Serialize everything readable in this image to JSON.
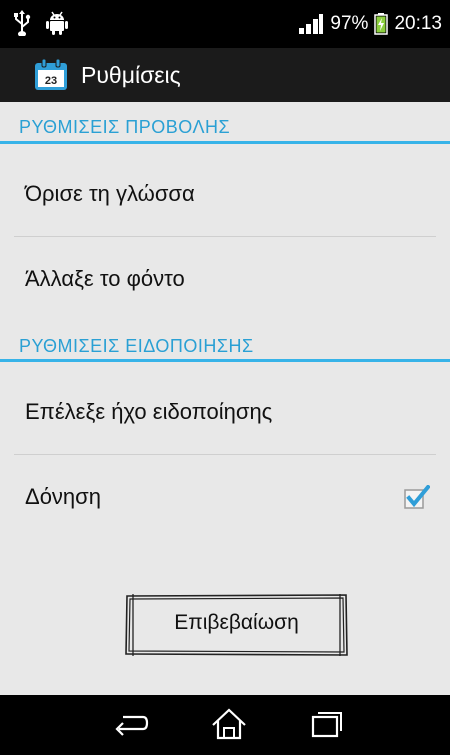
{
  "status_bar": {
    "icons": [
      "usb-icon",
      "android-icon",
      "signal-icon",
      "battery-charging-icon"
    ],
    "battery_percent": "97%",
    "time": "20:13"
  },
  "action_bar": {
    "app_icon": "calendar-icon",
    "app_icon_number": "23",
    "title": "Ρυθμίσεις"
  },
  "sections": [
    {
      "header": "ΡΥΘΜΙΣΕΙΣ ΠΡΟΒΟΛΗΣ",
      "items": [
        {
          "label": "Όρισε τη γλώσσα"
        },
        {
          "label": "Άλλαξε το φόντο"
        }
      ]
    },
    {
      "header": "ΡΥΘΜΙΣΕΙΣ ΕΙΔΟΠΟΙΗΣΗΣ",
      "items": [
        {
          "label": "Επέλεξε ήχο ειδοποίησης"
        },
        {
          "label": "Δόνηση",
          "checked": true
        }
      ]
    }
  ],
  "confirm_button": {
    "label": "Επιβεβαίωση"
  },
  "nav_bar": {
    "icons": [
      "back-icon",
      "home-icon",
      "recent-apps-icon"
    ]
  },
  "colors": {
    "accent": "#37b3e8",
    "header_text": "#2aa0d4",
    "background": "#e8e8e8"
  }
}
